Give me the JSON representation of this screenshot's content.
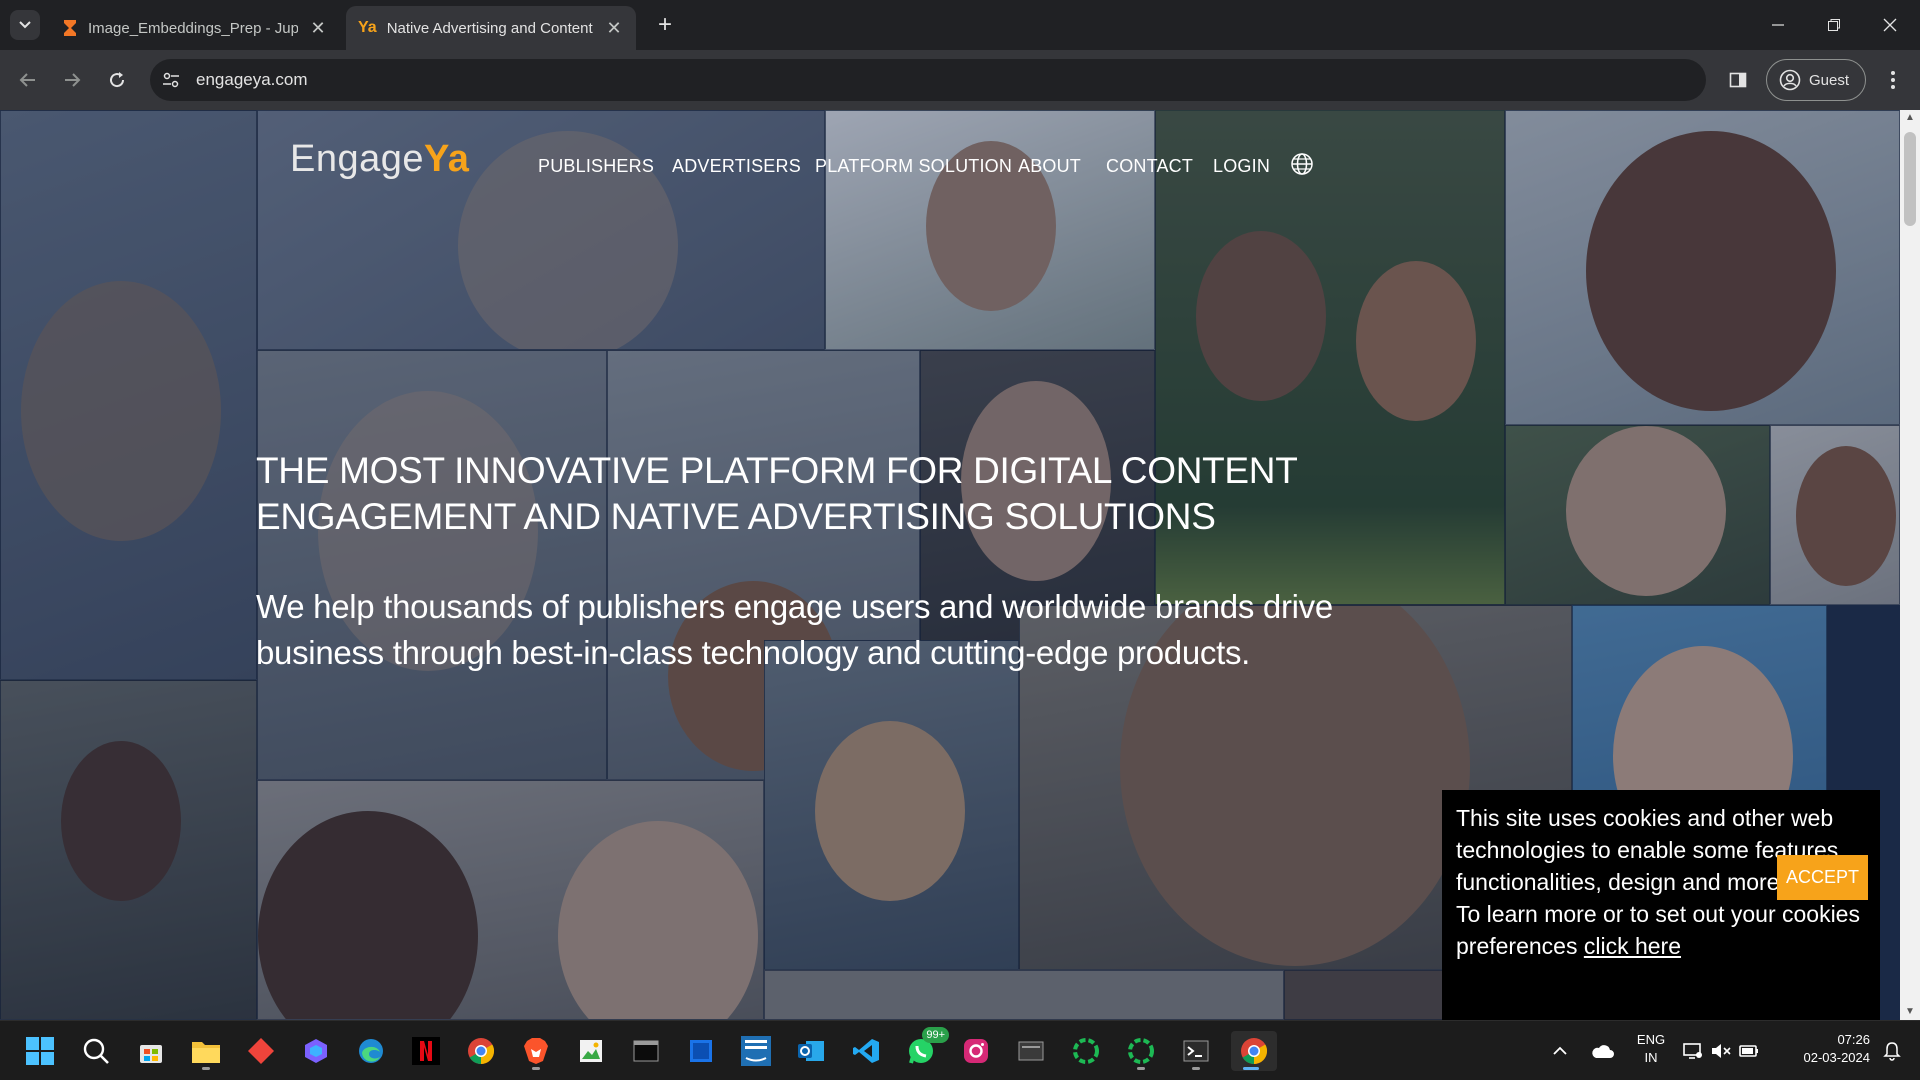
{
  "browser": {
    "tabs": [
      {
        "title": "Image_Embeddings_Prep - Jupy",
        "icon": "hourglass-icon",
        "active": false
      },
      {
        "title": "Native Advertising and Content",
        "icon": "ya-favicon",
        "active": true
      }
    ],
    "favicon_ya_text": "Ya",
    "url": "engageya.com",
    "profile_label": "Guest"
  },
  "page": {
    "logo_main": "Engage",
    "logo_accent": "Ya",
    "nav": [
      "PUBLISHERS",
      "ADVERTISERS",
      "PLATFORM SOLUTION",
      "ABOUT",
      "CONTACT",
      "LOGIN"
    ],
    "headline_line1": "THE MOST INNOVATIVE PLATFORM FOR DIGITAL CONTENT",
    "headline_line2": "ENGAGEMENT AND NATIVE ADVERTISING SOLUTIONS",
    "subline_line1": "We help thousands of publishers engage users and worldwide brands drive",
    "subline_line2": "business through best-in-class technology and cutting-edge products.",
    "cookie": {
      "line1": "This site uses cookies and other web",
      "line2": "technologies to enable some features,",
      "line3": "functionalities, design and more.",
      "line4": "To learn more or to set out your cookies",
      "line5_prefix": "preferences ",
      "link": "click here",
      "accept": "ACCEPT"
    },
    "colors": {
      "accent": "#f7a31a",
      "overlay": "#18284a"
    }
  },
  "taskbar": {
    "apps": [
      "windows-start-icon",
      "search-icon",
      "store-icon",
      "file-explorer-icon",
      "anydesk-icon",
      "copilot-icon",
      "edge-icon",
      "netflix-icon",
      "chrome-icon",
      "brave-icon",
      "image-viewer-icon",
      "terminal-icon",
      "app-icon",
      "prime-video-icon",
      "outlook-icon",
      "vscode-icon",
      "whatsapp-icon",
      "instagram-icon",
      "media-icon",
      "spotify-icon",
      "spotify-icon-2",
      "terminal-icon-2",
      "chrome-active-icon"
    ],
    "whatsapp_badge": "99+",
    "language": "ENG",
    "region": "IN",
    "time": "07:26",
    "date": "02-03-2024"
  }
}
